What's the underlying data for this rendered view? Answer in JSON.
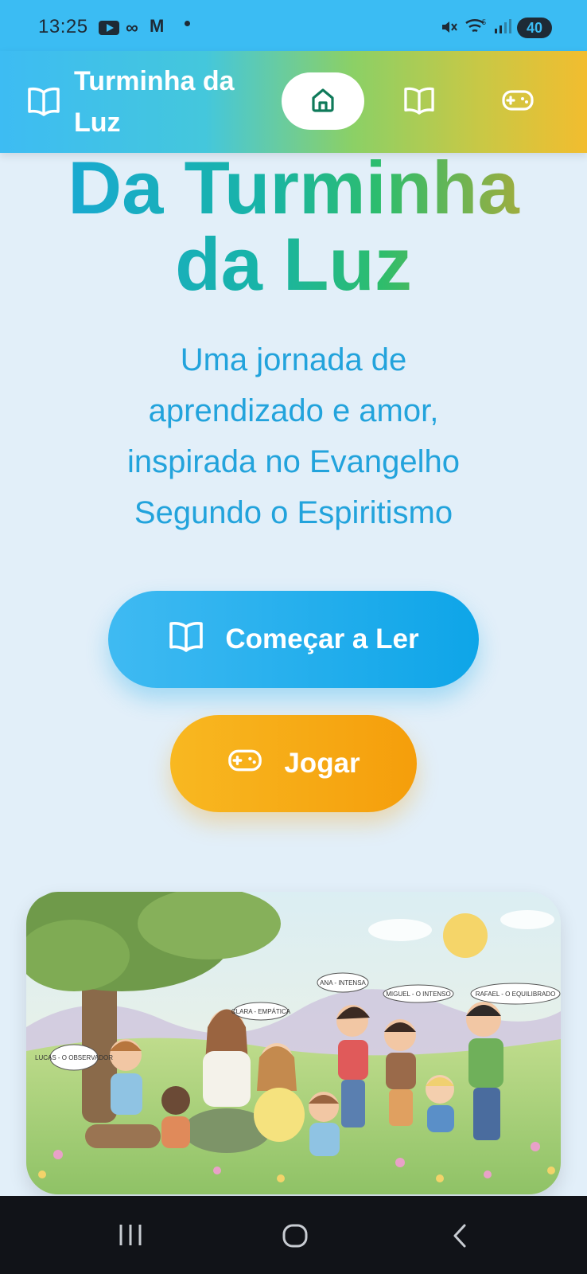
{
  "status_bar": {
    "time": "13:25",
    "battery": "40",
    "icons": [
      "youtube-icon",
      "voicemail-icon",
      "gmail-icon",
      "notification-dot-icon",
      "mute-icon",
      "wifi-icon",
      "signal-icon",
      "battery-icon"
    ]
  },
  "header": {
    "brand": "Turminha da Luz",
    "brand_icon": "open-book-icon",
    "nav": [
      {
        "icon": "home-icon",
        "active": true
      },
      {
        "icon": "book-icon",
        "active": false
      },
      {
        "icon": "gamepad-icon",
        "active": false
      }
    ],
    "accent_colors": [
      "#3dbcf3",
      "#8bd066",
      "#f2bd2f"
    ]
  },
  "hero": {
    "title_line1": "Da Turminha",
    "title_line2": "da Luz",
    "subtitle_line1": "Uma jornada de",
    "subtitle_line2": "aprendizado e amor,",
    "subtitle_line3": "inspirada no Evangelho",
    "subtitle_line4": "Segundo o Espiritismo"
  },
  "actions": {
    "read_label": "Começar a Ler",
    "play_label": "Jogar",
    "read_color": "#0ea5e8",
    "play_color": "#f59e0b"
  },
  "illustration": {
    "bubbles": [
      "LUCAS - O OBSERVADOR",
      "CLARA - EMPÁTICA",
      "ANA - INTENSA",
      "MIGUEL - O INTENSO",
      "RAFAEL - O EQUILIBRADO"
    ]
  },
  "system_nav": {
    "icons": [
      "recent-apps-icon",
      "home-icon",
      "back-icon"
    ]
  }
}
